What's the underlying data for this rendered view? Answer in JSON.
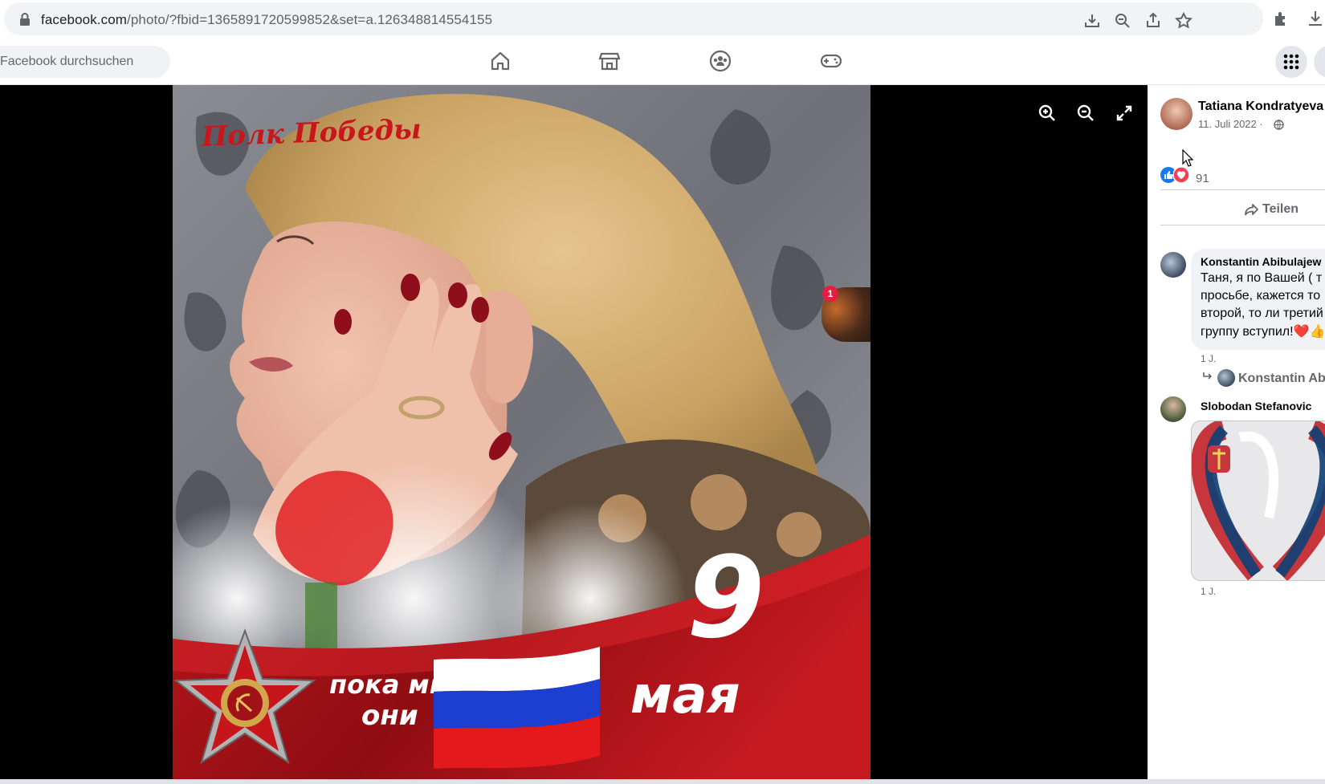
{
  "browser": {
    "url_host": "facebook.com",
    "url_path": "/photo/?fbid=1365891720599852&set=a.126348814554155"
  },
  "navbar": {
    "search_placeholder": "Facebook durchsuchen"
  },
  "photo": {
    "title_text": "Полк Победы",
    "banner_text_line1": "пока мы",
    "banner_text_line2": "они",
    "date_number": "9",
    "date_month": "мая",
    "flag_colors": [
      "#ffffff",
      "#1c3fd1",
      "#e3191b"
    ],
    "side_badge_count": "1"
  },
  "post": {
    "author": "Tatiana Kondratyeva",
    "date": "11. Juli 2022 ·",
    "reaction_count": "91",
    "share_label": "Teilen"
  },
  "comments": [
    {
      "author": "Konstantin Abibulajew",
      "text_lines": [
        "Таня, я по Вашей ( т",
        "просьбе, кажется то",
        "второй, то ли третий",
        "группу вступил!❤️👍"
      ],
      "time": "1 J.",
      "reply_author": "Konstantin Ab"
    },
    {
      "author": "Slobodan Stefanovic",
      "time": "1 J."
    }
  ],
  "colors": {
    "fb_blue": "#1877f2",
    "heart_red": "#f33e58",
    "viewer_bg": "#000000"
  }
}
